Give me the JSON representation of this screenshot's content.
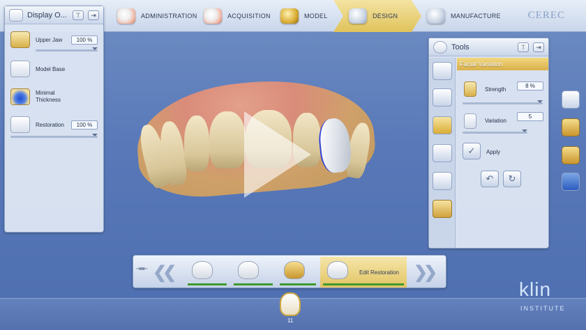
{
  "workflow": {
    "steps": [
      {
        "label": "ADMINISTRATION",
        "icon": "teeth-jaw-icon"
      },
      {
        "label": "ACQUISITION",
        "icon": "scan-jaw-icon"
      },
      {
        "label": "MODEL",
        "icon": "model-icon"
      },
      {
        "label": "DESIGN",
        "icon": "design-crown-icon",
        "active": true
      },
      {
        "label": "MANUFACTURE",
        "icon": "manufacture-icon"
      }
    ],
    "brand": "CEREC"
  },
  "display_options": {
    "title": "Display O...",
    "items": [
      {
        "label": "Upper Jaw",
        "value": "100 %"
      },
      {
        "label": "Model Base"
      },
      {
        "label": "Minimal Thickness"
      },
      {
        "label": "Restoration",
        "value": "100 %"
      }
    ]
  },
  "tools": {
    "title": "Tools",
    "section": "Facial Variation",
    "strength_label": "Strength",
    "strength_value": "8 %",
    "variation_label": "Variation",
    "variation_value": "5",
    "apply_label": "Apply"
  },
  "wizard": {
    "active_label": "Edit Restoration"
  },
  "tooth_number": "11",
  "watermark": {
    "main": "klin",
    "sub": "INSTITUTE"
  },
  "colors": {
    "accent_gold": "#d9b04a",
    "progress_green": "#3f9a2c"
  }
}
